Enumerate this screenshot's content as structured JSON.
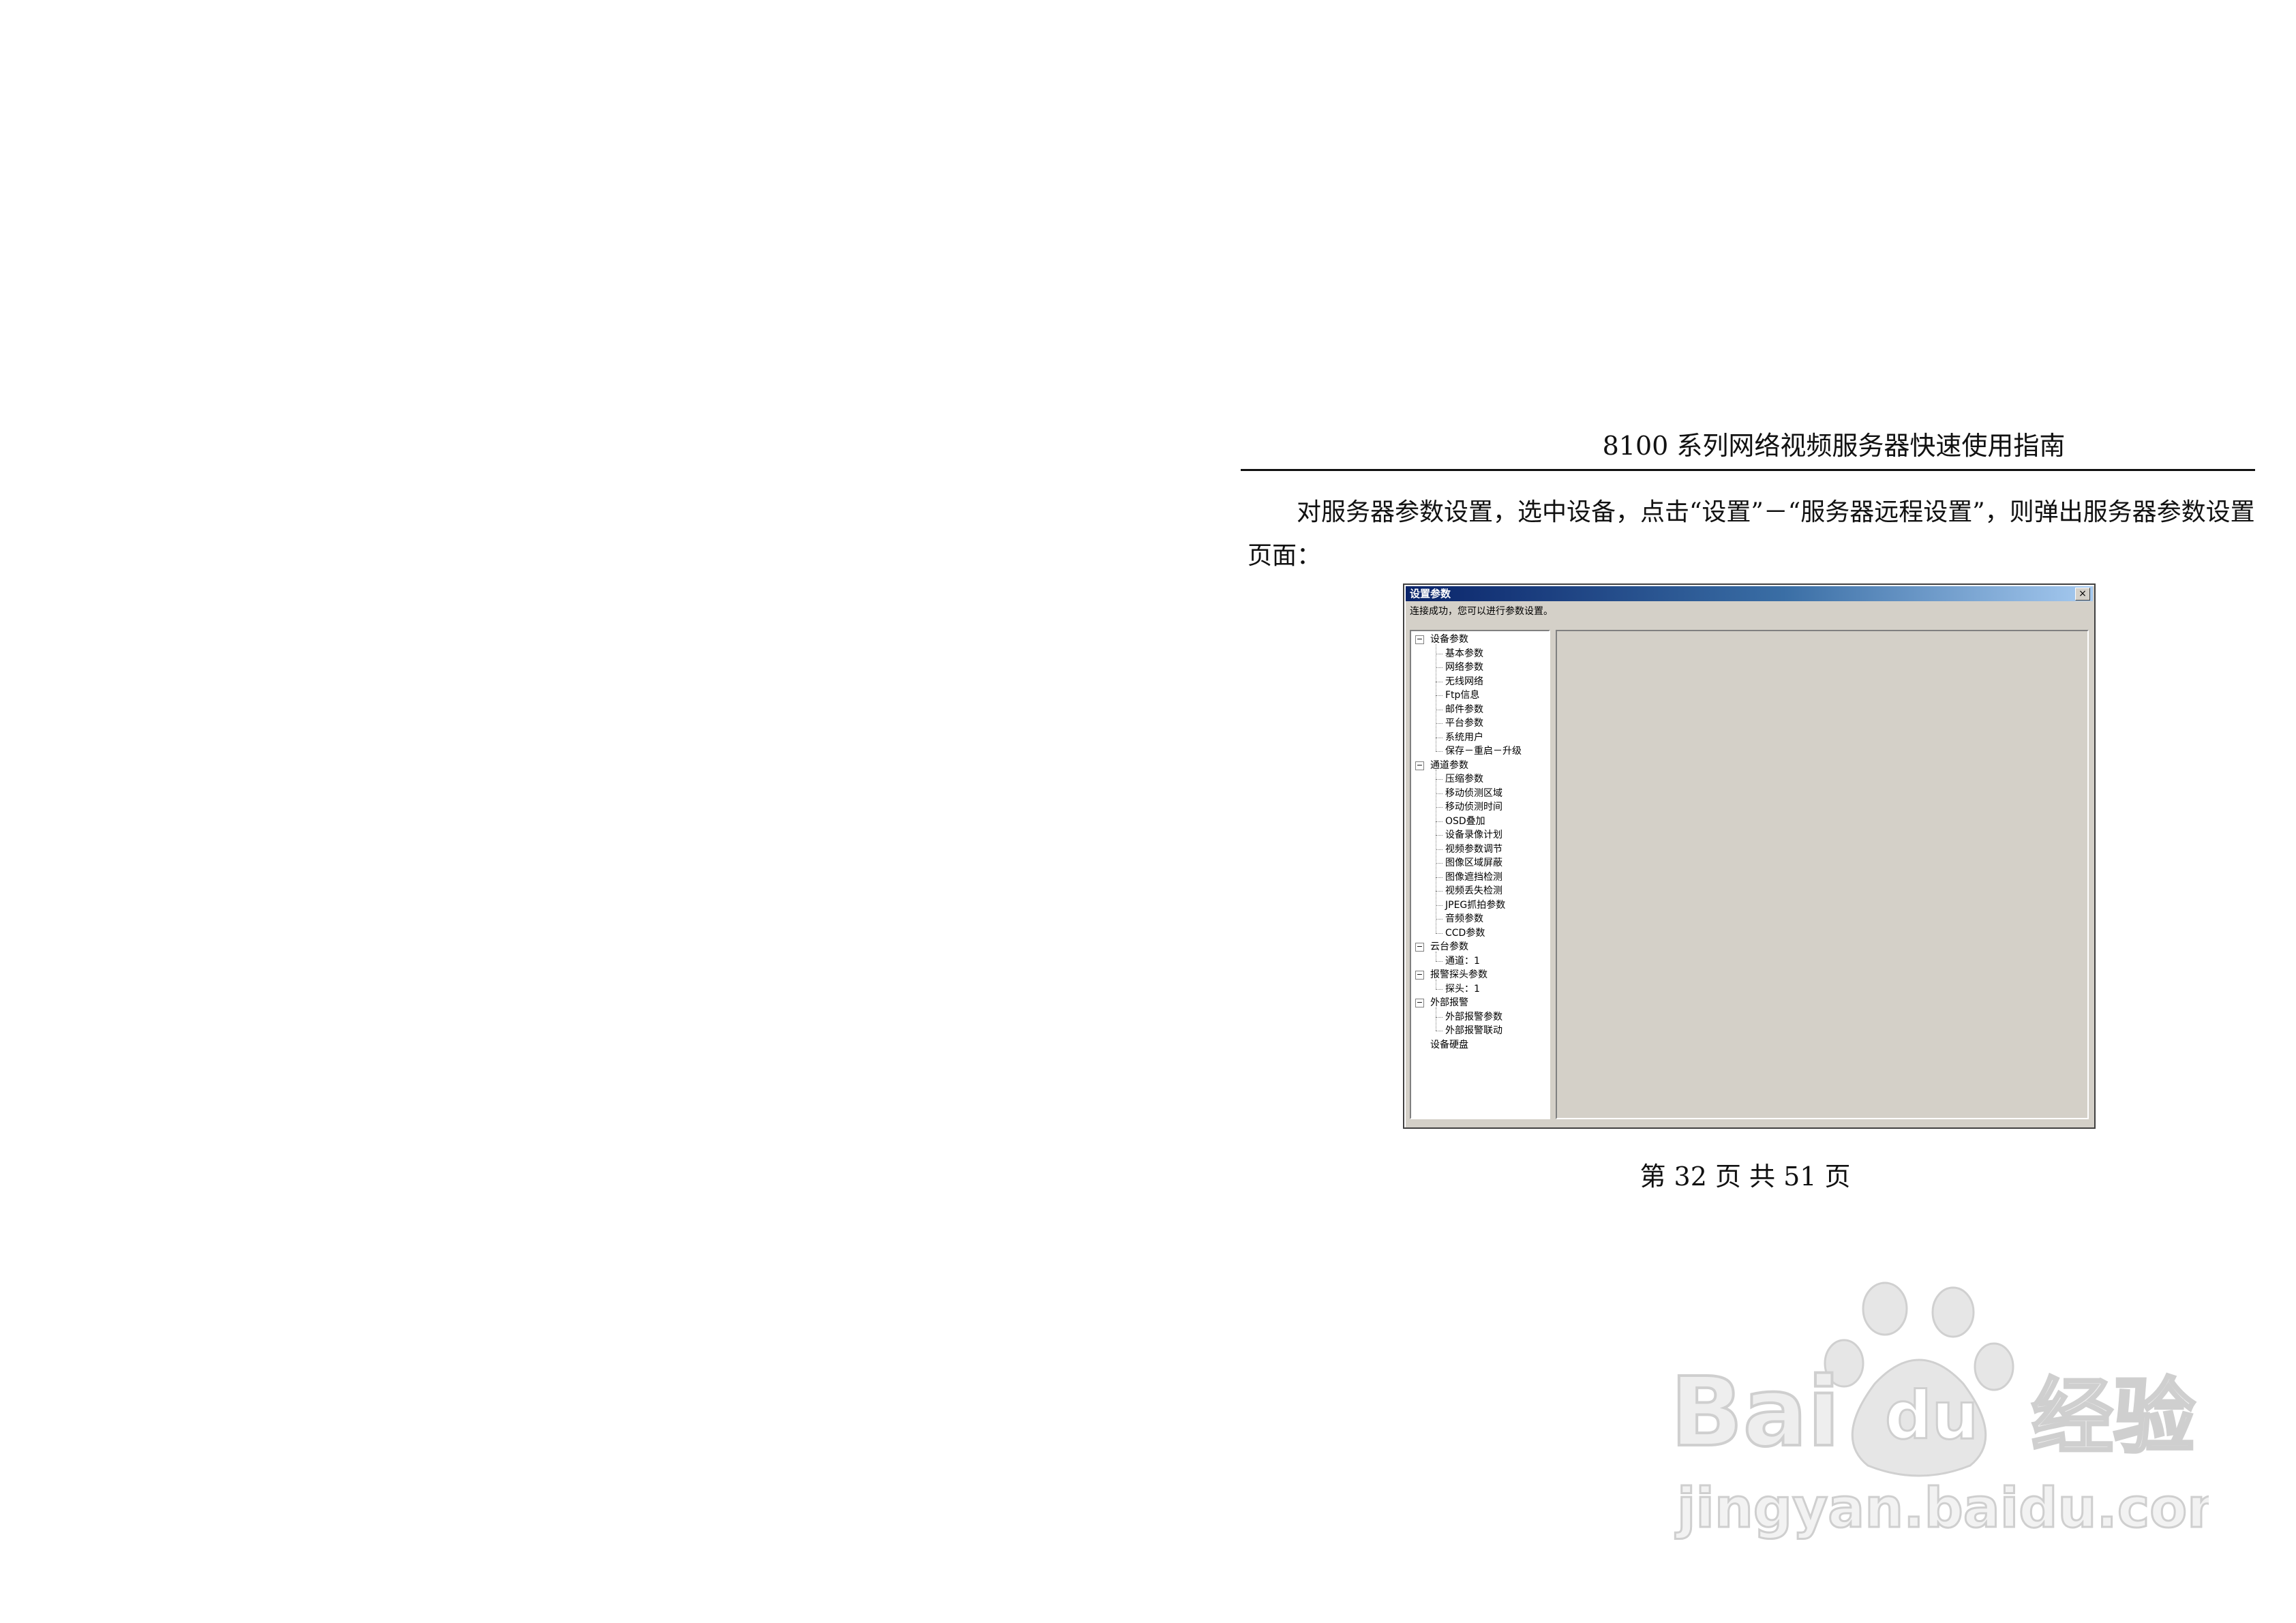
{
  "document": {
    "header": "8100 系列网络视频服务器快速使用指南",
    "paragraph": "对服务器参数设置，选中设备，点击“设置”－“服务器远程设置”，则弹出服务器参数设置页面：",
    "page_number": "第 32 页 共 51 页"
  },
  "dialog": {
    "title": "设置参数",
    "close_label": "×",
    "status_text": "连接成功，您可以进行参数设置。",
    "tree": {
      "groups": [
        {
          "label": "设备参数",
          "expander": "−",
          "items": [
            "基本参数",
            "网络参数",
            "无线网络",
            "Ftp信息",
            "邮件参数",
            "平台参数",
            "系统用户",
            "保存－重启－升级"
          ]
        },
        {
          "label": "通道参数",
          "expander": "−",
          "items": [
            "压缩参数",
            "移动侦测区域",
            "移动侦测时间",
            "OSD叠加",
            "设备录像计划",
            "视频参数调节",
            "图像区域屏蔽",
            "图像遮挡检测",
            "视频丢失检测",
            "JPEG抓拍参数",
            "音频参数",
            "CCD参数"
          ]
        },
        {
          "label": "云台参数",
          "expander": "−",
          "items": [
            "通道：1"
          ]
        },
        {
          "label": "报警探头参数",
          "expander": "−",
          "items": [
            "探头：1"
          ]
        },
        {
          "label": "外部报警",
          "expander": "−",
          "items": [
            "外部报警参数",
            "外部报警联动"
          ]
        },
        {
          "label": "设备硬盘",
          "expander": "",
          "items": []
        }
      ]
    }
  },
  "watermark": {
    "brand_text": "Bai du 经验",
    "url_text": "jingyan.baidu.com"
  }
}
